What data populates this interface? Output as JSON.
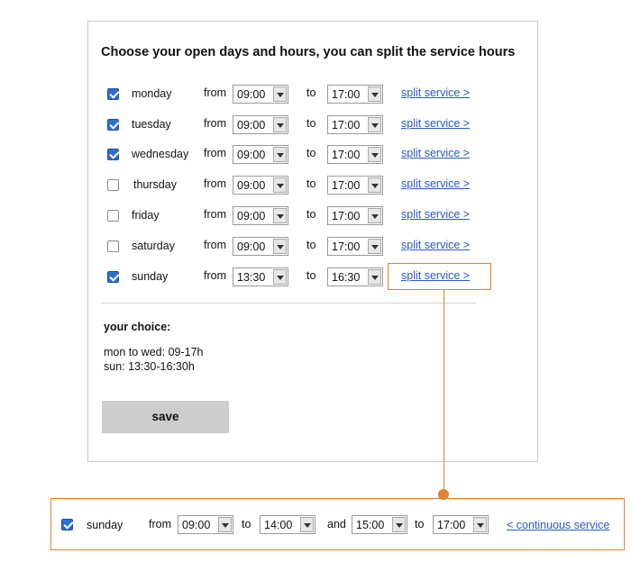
{
  "heading": "Choose your open days and hours, you can split the service hours",
  "labels": {
    "from": "from",
    "to": "to",
    "and": "and",
    "split": "split service >",
    "continuous": "< continuous service"
  },
  "days": [
    {
      "name": "monday",
      "checked": true,
      "from": "09:00",
      "to": "17:00"
    },
    {
      "name": "tuesday",
      "checked": true,
      "from": "09:00",
      "to": "17:00"
    },
    {
      "name": "wednesday",
      "checked": true,
      "from": "09:00",
      "to": "17:00"
    },
    {
      "name": "thursday",
      "checked": false,
      "from": "09:00",
      "to": "17:00"
    },
    {
      "name": "friday",
      "checked": false,
      "from": "09:00",
      "to": "17:00"
    },
    {
      "name": "saturday",
      "checked": false,
      "from": "09:00",
      "to": "17:00"
    },
    {
      "name": "sunday",
      "checked": true,
      "from": "13:30",
      "to": "16:30"
    }
  ],
  "choice": {
    "title": "your choice:",
    "lines": [
      "mon to wed: 09-17h",
      "sun: 13:30-16:30h"
    ]
  },
  "save_label": "save",
  "detail": {
    "day": "sunday",
    "checked": true,
    "from1": "09:00",
    "to1": "14:00",
    "from2": "15:00",
    "to2": "17:00"
  },
  "colors": {
    "accent": "#e0822f",
    "link": "#2a59c9",
    "checkbox": "#2f6fd2"
  }
}
